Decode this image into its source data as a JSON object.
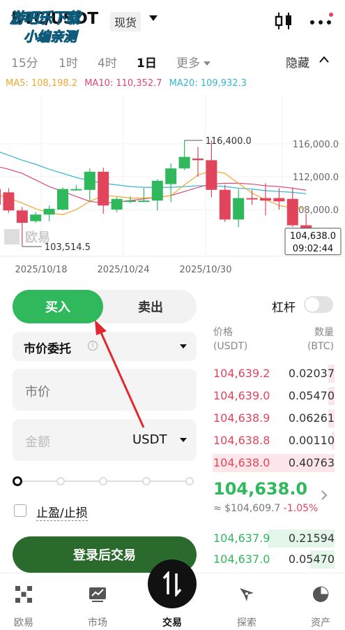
{
  "header": {
    "pair": "BTC/USDT",
    "market_type": "现货",
    "watermark_line1": "游吧乐下载",
    "watermark_line2": "小编亲测"
  },
  "timeframes": {
    "items": [
      "15分",
      "1时",
      "4时",
      "1日",
      "更多"
    ],
    "active": "1日",
    "hide_label": "隐藏"
  },
  "ma": {
    "ma5": "MA5: 108,198.2",
    "ma10": "MA10: 110,352.7",
    "ma20": "MA20: 109,932.3",
    "ma5_color": "#f0a830",
    "ma10_color": "#e0457c",
    "ma20_color": "#33b5d5"
  },
  "chart_data": {
    "type": "candlestick",
    "x_tick_labels": [
      "2025/10/18",
      "2025/10/24",
      "2025/10/30"
    ],
    "y_tick_labels": [
      "116,000.0",
      "112,000.0",
      "108,000.0"
    ],
    "ylim": [
      102500,
      122000
    ],
    "annotations": {
      "high": "116,400.0",
      "low": "103,514.5",
      "current_price": "104,638.0",
      "countdown": "09:02:44"
    },
    "logo_text": "欧易",
    "candles": [
      {
        "o": 110500,
        "h": 111200,
        "c": 108600,
        "l": 108300
      },
      {
        "o": 110100,
        "h": 110600,
        "c": 107900,
        "l": 107600
      },
      {
        "o": 107900,
        "h": 108300,
        "c": 106400,
        "l": 103514.5
      },
      {
        "o": 106600,
        "h": 107700,
        "c": 107400,
        "l": 106400
      },
      {
        "o": 107400,
        "h": 108500,
        "c": 108100,
        "l": 106600
      },
      {
        "o": 108000,
        "h": 110700,
        "c": 110500,
        "l": 107900
      },
      {
        "o": 110500,
        "h": 111000,
        "c": 110500,
        "l": 110300
      },
      {
        "o": 110400,
        "h": 113000,
        "c": 112600,
        "l": 108900
      },
      {
        "o": 112600,
        "h": 113100,
        "c": 108500,
        "l": 107500
      },
      {
        "o": 108000,
        "h": 109500,
        "c": 109300,
        "l": 107700
      },
      {
        "o": 109100,
        "h": 109600,
        "c": 109100,
        "l": 108800
      },
      {
        "o": 109100,
        "h": 110600,
        "c": 109100,
        "l": 108900
      },
      {
        "o": 109100,
        "h": 111700,
        "c": 111500,
        "l": 107900
      },
      {
        "o": 111100,
        "h": 113600,
        "c": 113000,
        "l": 108900
      },
      {
        "o": 113000,
        "h": 116400,
        "c": 114400,
        "l": 112800
      },
      {
        "o": 114200,
        "h": 115600,
        "c": 114000,
        "l": 112000
      },
      {
        "o": 114000,
        "h": 116400,
        "c": 110400,
        "l": 109500
      },
      {
        "o": 110400,
        "h": 111000,
        "c": 106800,
        "l": 106500
      },
      {
        "o": 106800,
        "h": 110500,
        "c": 109400,
        "l": 105900
      },
      {
        "o": 109400,
        "h": 110400,
        "c": 109300,
        "l": 108600
      },
      {
        "o": 109400,
        "h": 111200,
        "c": 109100,
        "l": 107300
      },
      {
        "o": 109400,
        "h": 110600,
        "c": 109000,
        "l": 108000
      },
      {
        "o": 109300,
        "h": 110700,
        "c": 106100,
        "l": 105900
      },
      {
        "o": 106100,
        "h": 107500,
        "c": 104638,
        "l": 103800
      }
    ],
    "ma5": [
      109900,
      109400,
      108800,
      108100,
      107600,
      107400,
      108000,
      109000,
      109700,
      109600,
      109400,
      109400,
      109500,
      109700,
      111000,
      112200,
      112700,
      112400,
      111200,
      110000,
      109200,
      108500,
      108200,
      108198
    ],
    "ma10": [
      113300,
      112900,
      112400,
      111600,
      110800,
      110200,
      109600,
      109000,
      108800,
      108900,
      109100,
      109300,
      109500,
      109700,
      110200,
      110700,
      111100,
      111200,
      111200,
      111100,
      110900,
      110800,
      110600,
      110353
    ],
    "ma20": [
      115200,
      114600,
      114000,
      113500,
      112900,
      112400,
      111900,
      111500,
      111200,
      111000,
      110800,
      110700,
      110700,
      110700,
      110800,
      110900,
      110900,
      110800,
      110600,
      110500,
      110300,
      110200,
      110100,
      109932
    ]
  },
  "trade": {
    "buy": "买入",
    "sell": "卖出",
    "order_type": "市价委托",
    "price_placeholder": "市价",
    "amount_placeholder": "金额",
    "amount_unit": "USDT",
    "slider_percent": 0,
    "tpsl": "止盈/止损",
    "login_button": "登录后交易"
  },
  "leverage": {
    "label": "杠杆",
    "enabled": false
  },
  "orderbook": {
    "price_header": "价格",
    "price_unit": "(USDT)",
    "qty_header": "数量",
    "qty_unit": "(BTC)",
    "asks": [
      {
        "price": "104,639.2",
        "qty": "0.02037",
        "depth": 0.05
      },
      {
        "price": "104,639.0",
        "qty": "0.05470",
        "depth": 0.05
      },
      {
        "price": "104,638.9",
        "qty": "0.06261",
        "depth": 0.05
      },
      {
        "price": "104,638.8",
        "qty": "0.00110",
        "depth": 0.02
      },
      {
        "price": "104,638.0",
        "qty": "0.40763",
        "depth": 1.0
      }
    ],
    "last_price": "104,638.0",
    "last_fiat": "≈ $104,609.7",
    "change": "-1.05%",
    "bids": [
      {
        "price": "104,637.9",
        "qty": "0.21594",
        "depth": 0.55
      },
      {
        "price": "104,637.0",
        "qty": "0.05470",
        "depth": 0.2
      }
    ]
  },
  "nav": {
    "items": [
      "欧易",
      "市场",
      "交易",
      "探索",
      "资产"
    ],
    "active": "交易"
  },
  "colors": {
    "up": "#2fb85c",
    "down": "#e0455c",
    "annotation_arrow": "#e0282e"
  }
}
